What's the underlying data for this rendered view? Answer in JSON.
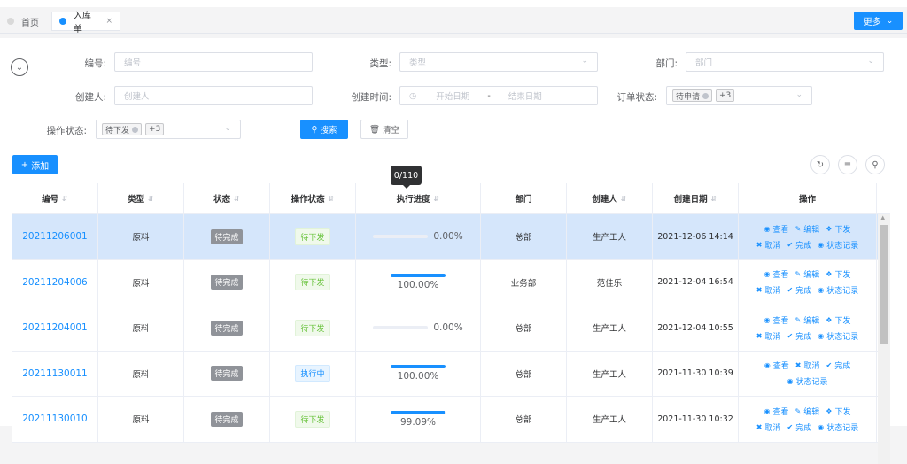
{
  "tabs": [
    {
      "label": "首页"
    },
    {
      "label": "入库单",
      "close": "×"
    }
  ],
  "more_button": "更多",
  "search": {
    "fields": {
      "code": {
        "label": "编号:",
        "placeholder": "编号"
      },
      "type": {
        "label": "类型:",
        "placeholder": "类型"
      },
      "dept": {
        "label": "部门:",
        "placeholder": "部门"
      },
      "creator": {
        "label": "创建人:",
        "placeholder": "创建人"
      },
      "created_time": {
        "label": "创建时间:",
        "start": "开始日期",
        "sep": "-",
        "end": "结束日期"
      },
      "order_status": {
        "label": "订单状态:",
        "tag": "待申请",
        "more": "+3"
      },
      "op_status": {
        "label": "操作状态:",
        "tag": "待下发",
        "more": "+3"
      }
    },
    "search_label": "搜索",
    "clear_label": "清空"
  },
  "add_label": "添加",
  "table": {
    "headers": [
      "编号",
      "类型",
      "状态",
      "操作状态",
      "执行进度",
      "部门",
      "创建人",
      "创建日期",
      "操作"
    ],
    "rows": [
      {
        "code": "20211206001",
        "type": "原料",
        "status": "待完成",
        "op_status": "待下发",
        "progress": 0,
        "progress_text": "0.00%",
        "dept": "总部",
        "creator": "生产工人",
        "date": "2021-12-06 14:14",
        "actions": [
          [
            "查看",
            "编辑",
            "下发"
          ],
          [
            "取消",
            "完成",
            "状态记录"
          ]
        ]
      },
      {
        "code": "20211204006",
        "type": "原料",
        "status": "待完成",
        "op_status": "待下发",
        "progress": 100,
        "progress_text": "100.00%",
        "dept": "业务部",
        "creator": "范佳乐",
        "date": "2021-12-04 16:54",
        "actions": [
          [
            "查看",
            "编辑",
            "下发"
          ],
          [
            "取消",
            "完成",
            "状态记录"
          ]
        ]
      },
      {
        "code": "20211204001",
        "type": "原料",
        "status": "待完成",
        "op_status": "待下发",
        "progress": 0,
        "progress_text": "0.00%",
        "dept": "总部",
        "creator": "生产工人",
        "date": "2021-12-04 10:55",
        "actions": [
          [
            "查看",
            "编辑",
            "下发"
          ],
          [
            "取消",
            "完成",
            "状态记录"
          ]
        ]
      },
      {
        "code": "20211130011",
        "type": "原料",
        "status": "待完成",
        "op_status": "执行中",
        "progress": 100,
        "progress_text": "100.00%",
        "dept": "总部",
        "creator": "生产工人",
        "date": "2021-11-30 10:39",
        "actions": [
          [
            "查看",
            "取消",
            "完成"
          ],
          [
            "状态记录"
          ]
        ]
      },
      {
        "code": "20211130010",
        "type": "原料",
        "status": "待完成",
        "op_status": "待下发",
        "progress": 99.09,
        "progress_text": "99.09%",
        "dept": "总部",
        "creator": "生产工人",
        "date": "2021-11-30 10:32",
        "actions": [
          [
            "查看",
            "编辑",
            "下发"
          ],
          [
            "取消",
            "完成",
            "状态记录"
          ]
        ]
      }
    ]
  },
  "tooltip": "0/110"
}
